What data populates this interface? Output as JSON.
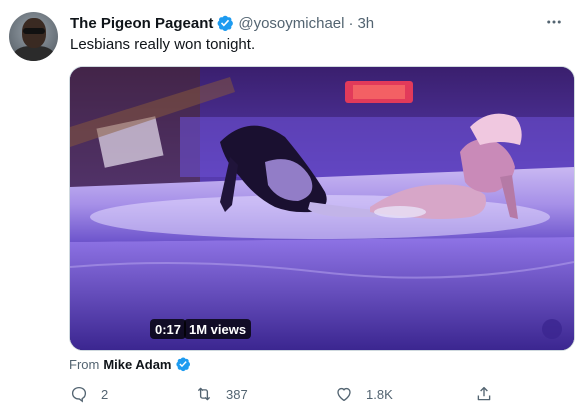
{
  "tweet": {
    "display_name": "The Pigeon Pageant",
    "handle": "@yosoymichael",
    "separator": "·",
    "time": "3h",
    "text": "Lesbians really won tonight.",
    "more_icon": "more-dots-icon"
  },
  "media": {
    "duration": "0:17",
    "views": "1M views"
  },
  "attribution": {
    "prefix": "From",
    "author": "Mike Adam"
  },
  "actions": {
    "reply_count": "2",
    "retweet_count": "387",
    "like_count": "1.8K"
  },
  "colors": {
    "verified": "#1d9bf0",
    "secondary_text": "#536471",
    "primary_text": "#0f1419"
  }
}
